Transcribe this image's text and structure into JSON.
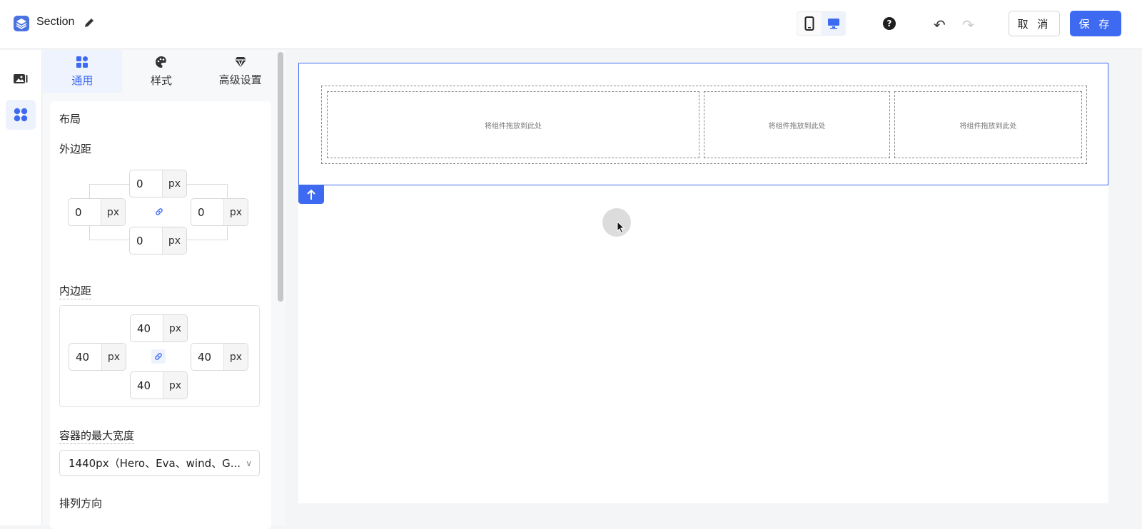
{
  "app": {
    "title": "Section"
  },
  "toolbar": {
    "cancel_label": "取 消",
    "save_label": "保 存",
    "help_label": "?"
  },
  "panel": {
    "tabs": [
      {
        "label": "通用",
        "icon": "grid-icon",
        "active": true
      },
      {
        "label": "样式",
        "icon": "palette-icon",
        "active": false
      },
      {
        "label": "高级设置",
        "icon": "diamond-icon",
        "active": false
      }
    ],
    "layout_label": "布局",
    "margin": {
      "label": "外边距",
      "top": "0",
      "left": "0",
      "right": "0",
      "bottom": "0",
      "unit": "px"
    },
    "padding": {
      "label": "内边距",
      "top": "40",
      "left": "40",
      "right": "40",
      "bottom": "40",
      "unit": "px"
    },
    "max_width": {
      "label": "容器的最大宽度",
      "value": "1440px（Hero、Eva、wind、G..."
    },
    "direction_label": "排列方向"
  },
  "canvas": {
    "dropzones": [
      "将组件拖放到此处",
      "将组件拖放到此处",
      "将组件拖放到此处"
    ]
  },
  "colors": {
    "accent": "#3d6af0"
  }
}
